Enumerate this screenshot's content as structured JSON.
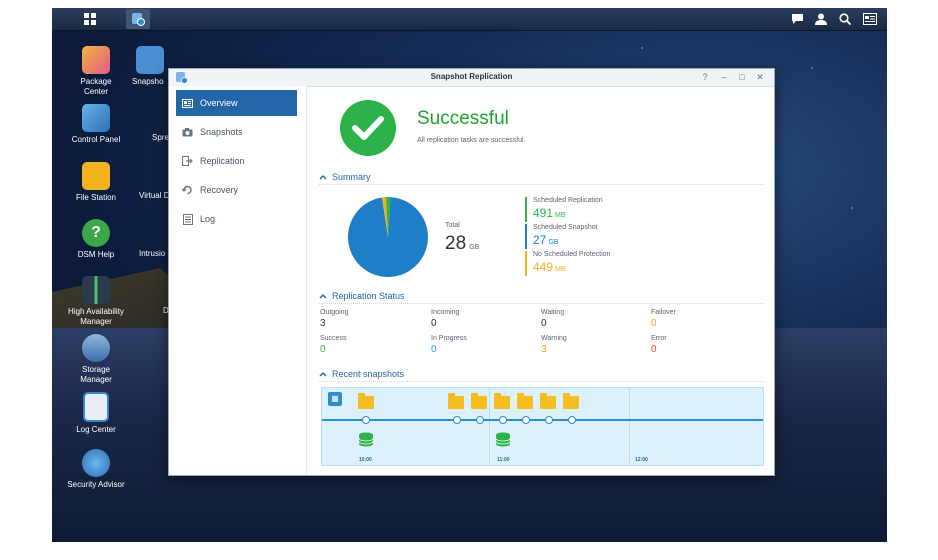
{
  "window": {
    "title": "Snapshot Replication",
    "controls": [
      "?",
      "–",
      "□",
      "✕"
    ]
  },
  "desktop_icons": [
    {
      "label": "Package\nCenter",
      "color": "#f0b43a"
    },
    {
      "label": "Control Panel",
      "color": "#3a86c9"
    },
    {
      "label": "File Station",
      "color": "#f3b21f"
    },
    {
      "label": "DSM Help",
      "color": "#3aa84a"
    },
    {
      "label": "High Availability\nManager",
      "color": "#2d3a4d"
    },
    {
      "label": "Storage\nManager",
      "color": "#5a8bc7"
    },
    {
      "label": "Log Center",
      "color": "#e8eef5"
    },
    {
      "label": "Security Advisor",
      "color": "#3a86c9"
    },
    {
      "label": "Snapsho",
      "color": "#4a8fd3"
    },
    {
      "label": "Sprea",
      "color": "#3aa84a"
    },
    {
      "label": "Virtual D",
      "color": "#3a86c9"
    },
    {
      "label": "Intrusio",
      "color": "#3a86c9"
    },
    {
      "label": "D",
      "color": "#3a86c9"
    }
  ],
  "sidebar": {
    "items": [
      {
        "label": "Overview",
        "icon": "overview-icon",
        "active": true
      },
      {
        "label": "Snapshots",
        "icon": "camera-icon",
        "active": false
      },
      {
        "label": "Replication",
        "icon": "replication-icon",
        "active": false
      },
      {
        "label": "Recovery",
        "icon": "recovery-icon",
        "active": false
      },
      {
        "label": "Log",
        "icon": "log-icon",
        "active": false
      }
    ]
  },
  "status": {
    "title": "Successful",
    "subtitle": "All replication tasks are successful."
  },
  "summary": {
    "heading": "Summary",
    "total_label": "Total",
    "total_value": "28",
    "total_unit": "GB",
    "legend": [
      {
        "label": "Scheduled Replication",
        "value": "491",
        "unit": "MB",
        "color": "#2bb34a"
      },
      {
        "label": "Scheduled Snapshot",
        "value": "27",
        "unit": "GB",
        "color": "#1e7fc8"
      },
      {
        "label": "No Scheduled Protection",
        "value": "449",
        "unit": "MB",
        "color": "#f2b01e"
      }
    ],
    "pie": [
      {
        "name": "Scheduled Snapshot",
        "value": 27.0,
        "color": "#1e7fc8"
      },
      {
        "name": "No Scheduled Protection",
        "value": 0.449,
        "color": "#f2b01e"
      },
      {
        "name": "Scheduled Replication",
        "value": 0.491,
        "color": "#2bb34a"
      }
    ]
  },
  "replication_status": {
    "heading": "Replication Status",
    "items": [
      {
        "label": "Outgoing",
        "value": "3",
        "color": "#333333"
      },
      {
        "label": "Incoming",
        "value": "0",
        "color": "#333333"
      },
      {
        "label": "Waiting",
        "value": "0",
        "color": "#333333"
      },
      {
        "label": "Failover",
        "value": "0",
        "color": "#f2a01e"
      },
      {
        "label": "Success",
        "value": "0",
        "color": "#2bb34a"
      },
      {
        "label": "In Progress",
        "value": "0",
        "color": "#1e9fd8"
      },
      {
        "label": "Warning",
        "value": "3",
        "color": "#f2a01e"
      },
      {
        "label": "Error",
        "value": "0",
        "color": "#e84b3c"
      }
    ]
  },
  "recent_snapshots": {
    "heading": "Recent snapshots",
    "times": [
      "10:00",
      "11:00",
      "12:00"
    ]
  }
}
